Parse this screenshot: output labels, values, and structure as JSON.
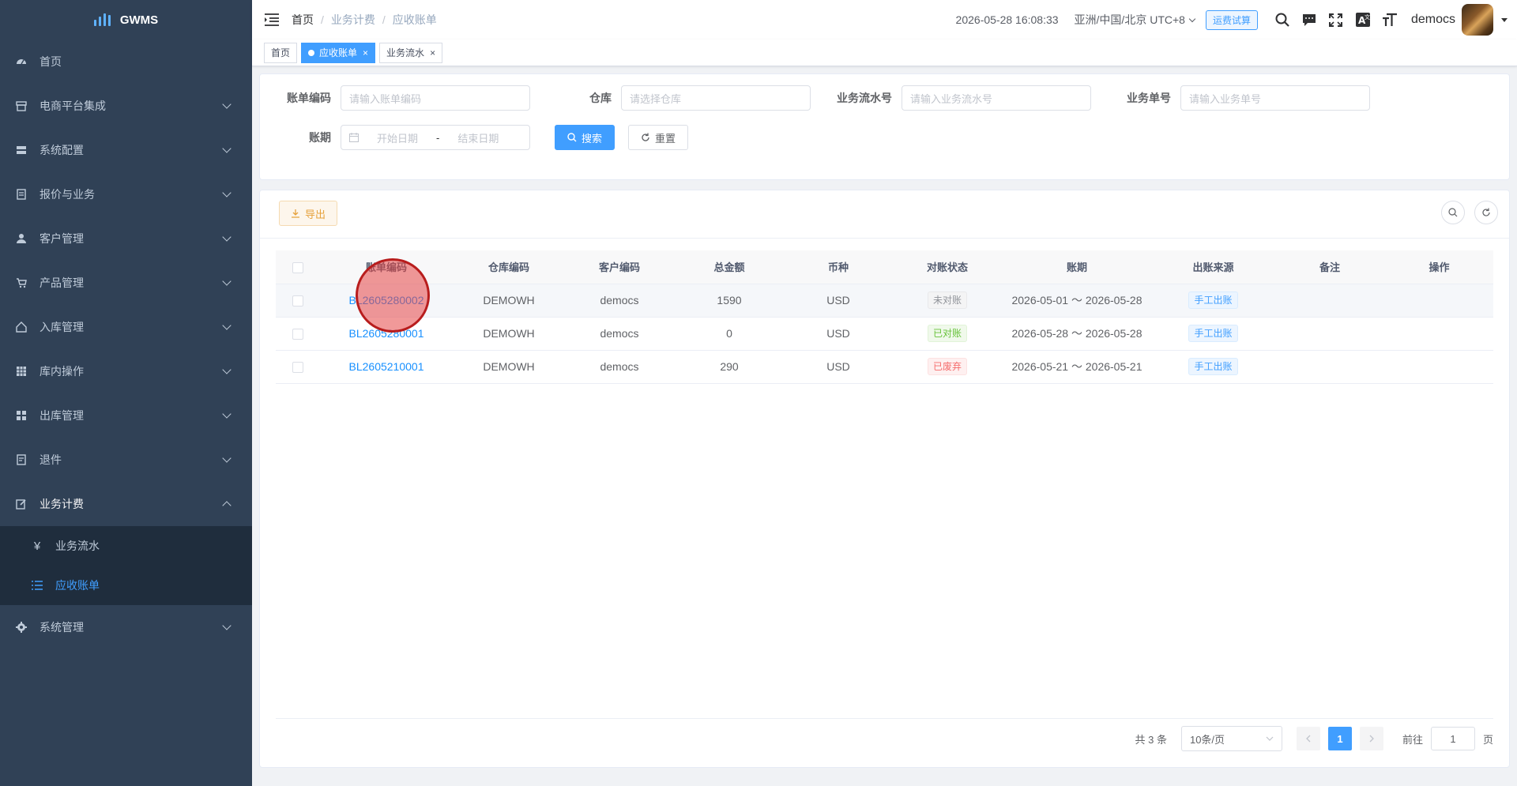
{
  "app": {
    "title": "GWMS"
  },
  "sidebar": {
    "items": [
      {
        "label": "首页",
        "icon": "dashboard-icon"
      },
      {
        "label": "电商平台集成",
        "icon": "store-icon"
      },
      {
        "label": "系统配置",
        "icon": "server-icon"
      },
      {
        "label": "报价与业务",
        "icon": "document-icon"
      },
      {
        "label": "客户管理",
        "icon": "user-icon"
      },
      {
        "label": "产品管理",
        "icon": "cart-icon"
      },
      {
        "label": "入库管理",
        "icon": "home-icon"
      },
      {
        "label": "库内操作",
        "icon": "grid-icon"
      },
      {
        "label": "出库管理",
        "icon": "apps-icon"
      },
      {
        "label": "退件",
        "icon": "return-icon"
      },
      {
        "label": "业务计费",
        "icon": "edit-icon"
      },
      {
        "label": "系统管理",
        "icon": "gear-icon"
      }
    ],
    "submenu": [
      {
        "label": "业务流水",
        "icon": "yen-icon"
      },
      {
        "label": "应收账单",
        "icon": "list-icon"
      }
    ]
  },
  "navbar": {
    "breadcrumb": [
      "首页",
      "业务计费",
      "应收账单"
    ],
    "datetime": "2026-05-28 16:08:33",
    "timezone": "亚洲/中国/北京 UTC+8",
    "fee_button": "运费试算",
    "username": "democs"
  },
  "tags": [
    {
      "label": "首页"
    },
    {
      "label": "应收账单"
    },
    {
      "label": "业务流水"
    }
  ],
  "search": {
    "bill_code_label": "账单编码",
    "bill_code_placeholder": "请输入账单编码",
    "warehouse_label": "仓库",
    "warehouse_placeholder": "请选择仓库",
    "flow_no_label": "业务流水号",
    "flow_no_placeholder": "请输入业务流水号",
    "biz_no_label": "业务单号",
    "biz_no_placeholder": "请输入业务单号",
    "period_label": "账期",
    "start_placeholder": "开始日期",
    "range_sep": "-",
    "end_placeholder": "结束日期",
    "search_btn": "搜索",
    "reset_btn": "重置"
  },
  "toolbar": {
    "export_btn": "导出"
  },
  "table": {
    "columns": [
      "账单编码",
      "仓库编码",
      "客户编码",
      "总金额",
      "币种",
      "对账状态",
      "账期",
      "出账来源",
      "备注",
      "操作"
    ],
    "rows": [
      {
        "code": "BL2605280002",
        "warehouse": "DEMOWH",
        "customer": "democs",
        "amount": "1590",
        "currency": "USD",
        "status": "未对账",
        "status_color": "gray",
        "period": "2026-05-01 ～ 2026-05-28",
        "source": "手工出账",
        "remark": "",
        "op": ""
      },
      {
        "code": "BL2605280001",
        "warehouse": "DEMOWH",
        "customer": "democs",
        "amount": "0",
        "currency": "USD",
        "status": "已对账",
        "status_color": "green",
        "period": "2026-05-28 ～ 2026-05-28",
        "source": "手工出账",
        "remark": "",
        "op": ""
      },
      {
        "code": "BL2605210001",
        "warehouse": "DEMOWH",
        "customer": "democs",
        "amount": "290",
        "currency": "USD",
        "status": "已废弃",
        "status_color": "red",
        "period": "2026-05-21 ～ 2026-05-21",
        "source": "手工出账",
        "remark": "",
        "op": ""
      }
    ]
  },
  "pagination": {
    "total": "共 3 条",
    "page_size": "10条/页",
    "current": "1",
    "goto_label": "前往",
    "goto_value": "1",
    "page_suffix": "页"
  },
  "colors": {
    "sidebar_bg": "#304156",
    "primary": "#409eff",
    "submenu_bg": "#1f2d3d"
  }
}
